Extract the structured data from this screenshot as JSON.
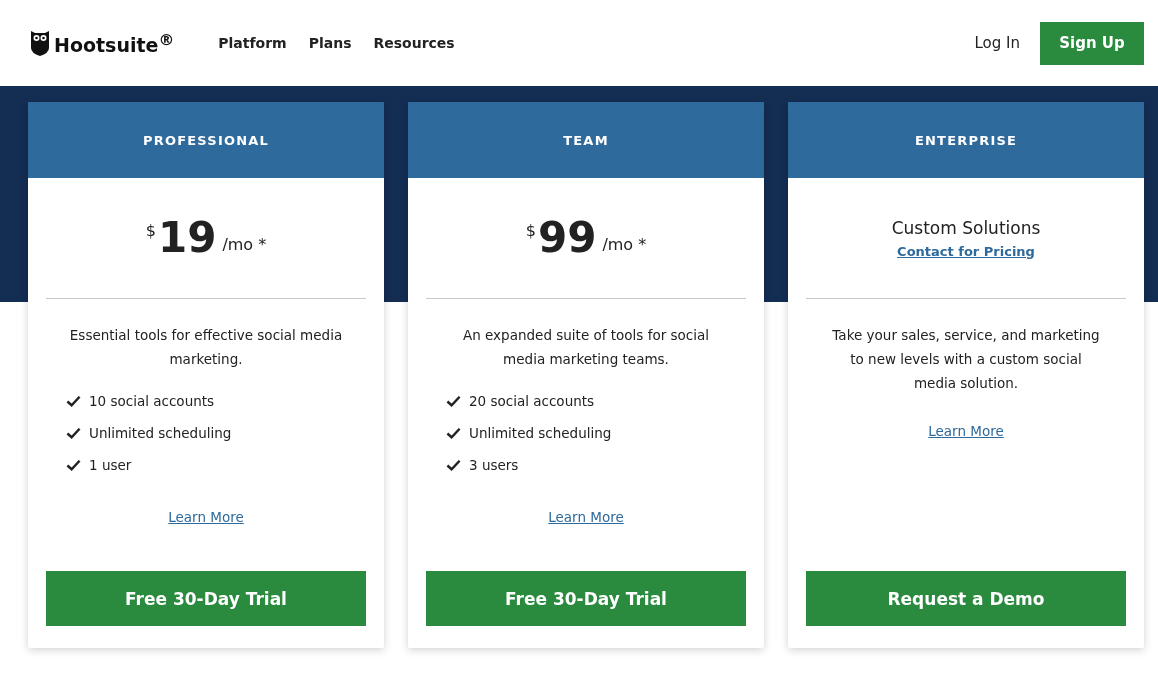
{
  "header": {
    "brand": "Hootsuite$^{®}$",
    "nav": [
      "Platform",
      "Plans",
      "Resources"
    ],
    "login": "Log In",
    "signup": "Sign Up"
  },
  "plans": [
    {
      "kind": "price",
      "name": "PROFESSIONAL",
      "currency": "$",
      "amount": "19",
      "period": "/mo *",
      "description": "Essential tools for effective social media marketing.",
      "features": [
        "10 social accounts",
        "Unlimited scheduling",
        "1 user"
      ],
      "learn_more": "Learn More",
      "cta": "Free 30-Day Trial"
    },
    {
      "kind": "price",
      "name": "TEAM",
      "currency": "$",
      "amount": "99",
      "period": "/mo *",
      "description": "An expanded suite of tools for social media marketing teams.",
      "features": [
        "20 social accounts",
        "Unlimited scheduling",
        "3 users"
      ],
      "learn_more": "Learn More",
      "cta": "Free 30-Day Trial"
    },
    {
      "kind": "custom",
      "name": "ENTERPRISE",
      "title": "Custom Solutions",
      "pricing_link": "Contact for Pricing",
      "description": "Take your sales, service, and marketing to new levels with a custom social media solution.",
      "learn_more": "Learn More",
      "cta": "Request a Demo"
    }
  ]
}
